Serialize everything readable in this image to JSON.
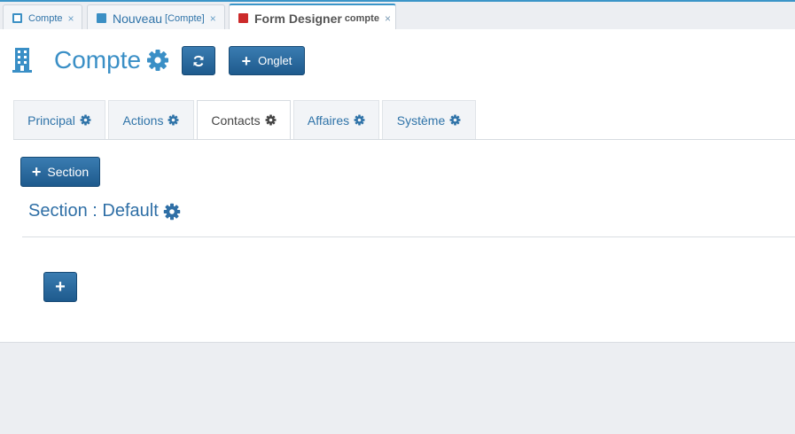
{
  "doc_tabs": [
    {
      "title": "Compte",
      "subtitle": "",
      "close": "×"
    },
    {
      "title": "Nouveau",
      "subtitle": "[Compte]",
      "close": "×"
    },
    {
      "title": "Form Designer",
      "subtitle": "compte",
      "close": "×"
    }
  ],
  "header": {
    "entity_title": "Compte",
    "onglet_label": "Onglet",
    "plus": "+"
  },
  "form_tabs": [
    {
      "label": "Principal"
    },
    {
      "label": "Actions"
    },
    {
      "label": "Contacts"
    },
    {
      "label": "Affaires"
    },
    {
      "label": "Système"
    }
  ],
  "section": {
    "add_label": "Section",
    "plus": "+",
    "title": "Section : Default"
  },
  "colors": {
    "accent": "#3a8fc6",
    "button": "#1e5a8d",
    "active_tab_marker": "#cc2a2a"
  }
}
